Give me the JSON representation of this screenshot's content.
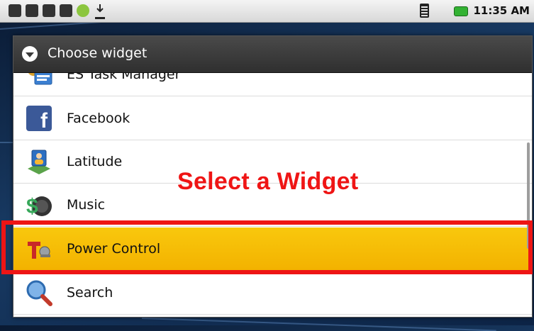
{
  "statusbar": {
    "time": "11:35 AM"
  },
  "dialog": {
    "title": "Choose widget",
    "items": [
      {
        "label": "ES Task Manager",
        "icon": "task-manager-icon"
      },
      {
        "label": "Facebook",
        "icon": "facebook-icon"
      },
      {
        "label": "Latitude",
        "icon": "latitude-icon"
      },
      {
        "label": "Music",
        "icon": "music-icon"
      },
      {
        "label": "Power Control",
        "icon": "power-control-icon",
        "selected": true
      },
      {
        "label": "Search",
        "icon": "search-icon"
      }
    ]
  },
  "annotation": {
    "text": "Select a Widget",
    "color": "#ee1515"
  },
  "colors": {
    "selected_bg": "#f5b800",
    "header_bg": "#3a3a3a"
  }
}
